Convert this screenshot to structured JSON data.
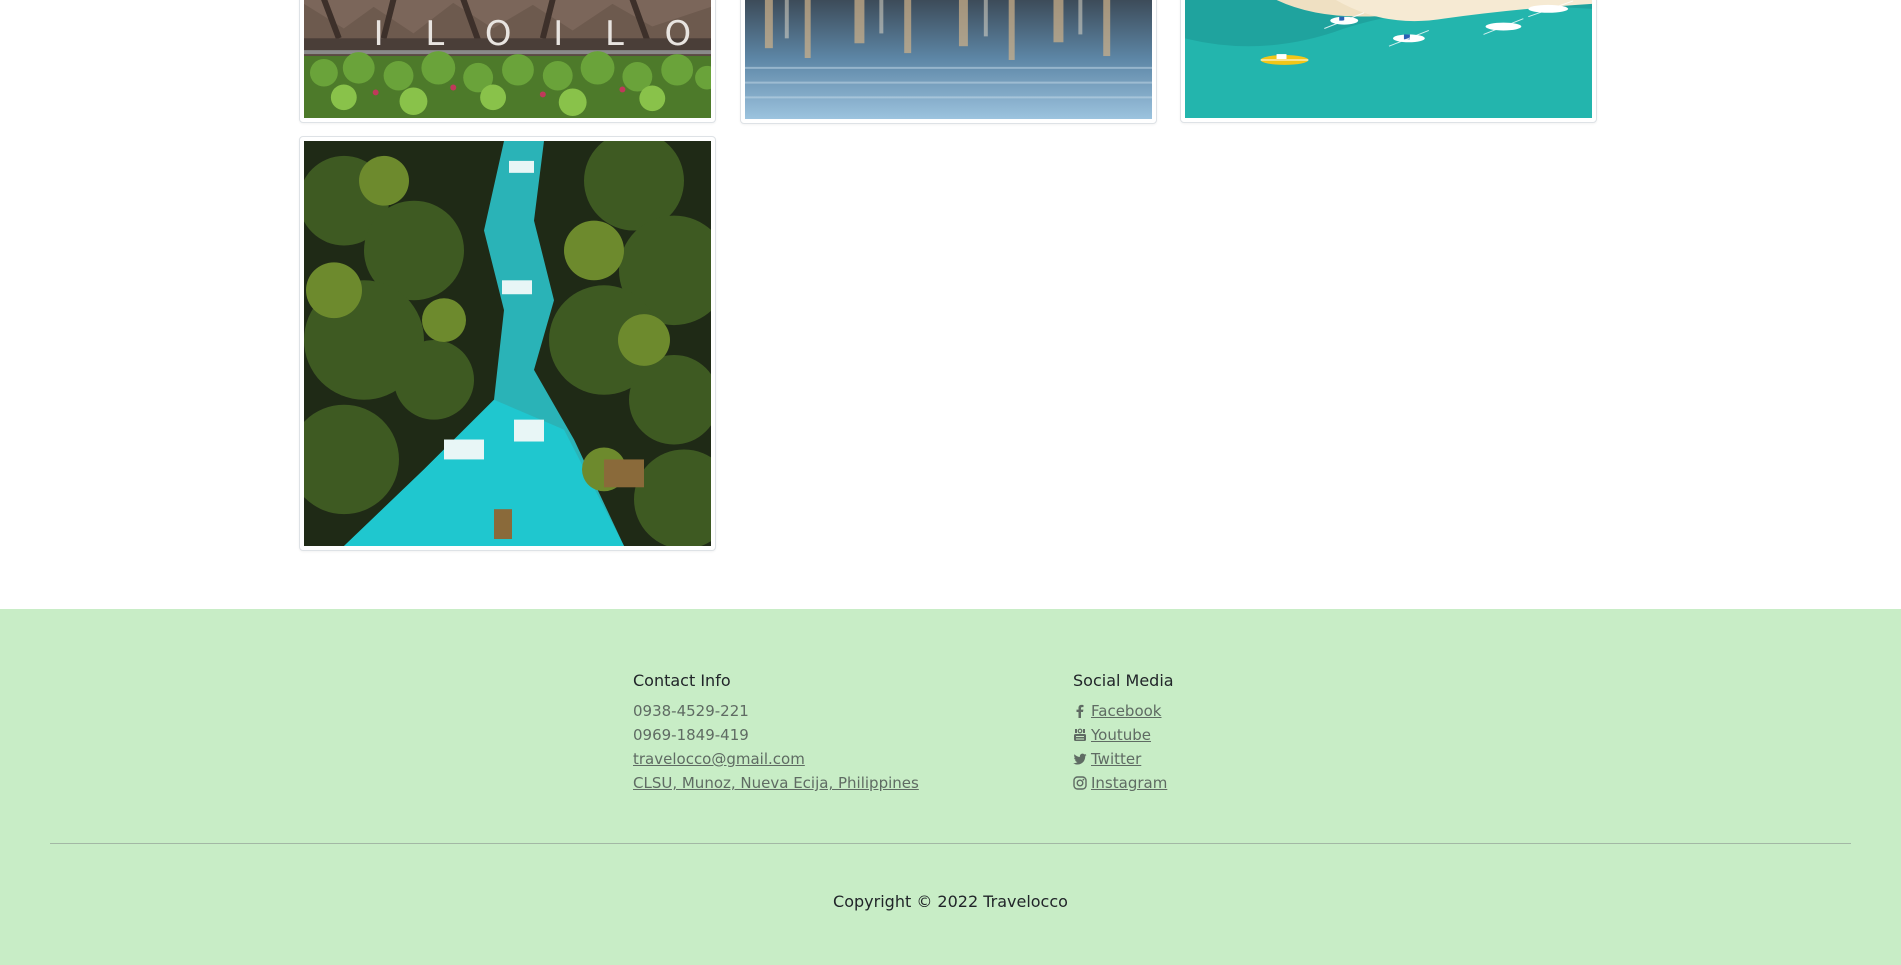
{
  "contact": {
    "heading": "Contact Info",
    "phone1": "0938-4529-221",
    "phone2": "0969-1849-419",
    "email": "travelocco@gmail.com",
    "address": "CLSU, Munoz, Nueva Ecija, Philippines"
  },
  "social": {
    "heading": "Social Media",
    "items": [
      {
        "label": "Facebook",
        "icon": "facebook-icon"
      },
      {
        "label": "Youtube",
        "icon": "youtube-icon"
      },
      {
        "label": "Twitter",
        "icon": "twitter-icon"
      },
      {
        "label": "Instagram",
        "icon": "instagram-icon"
      }
    ]
  },
  "gallery": {
    "sign_text": "ILOILO"
  },
  "footer": {
    "copyright": "Copyright © 2022 Travelocco",
    "background": "#c8edc6"
  }
}
